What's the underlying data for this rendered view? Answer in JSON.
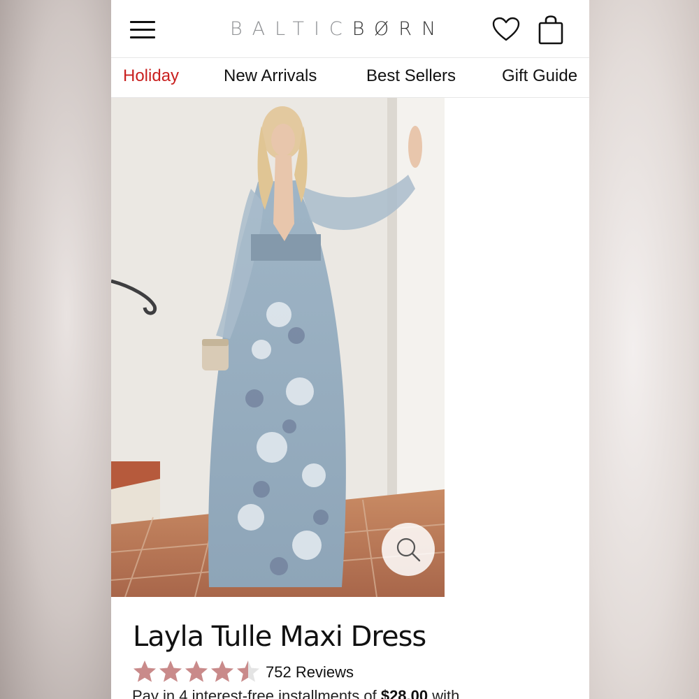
{
  "header": {
    "logo_light": "BALTIC",
    "logo_dark": "BØRN",
    "icons": [
      "menu-icon",
      "heart-icon",
      "shopping-bag-icon"
    ]
  },
  "nav": {
    "items": [
      {
        "label": "Holiday",
        "color": "#c9201f"
      },
      {
        "label": "New Arrivals"
      },
      {
        "label": "Best Sellers"
      },
      {
        "label": "Gift Guide"
      }
    ]
  },
  "product": {
    "title": "Layla Tulle Maxi Dress",
    "rating": 4.5,
    "rating_max": 5,
    "star_color": "#c98a8a",
    "reviews_label": "752 Reviews",
    "installments_prefix": "Pay in 4 interest-free installments of ",
    "installment_amount": "$28.00",
    "installments_suffix": " with"
  },
  "colors": {
    "accent": "#c9201f",
    "text": "#111111"
  }
}
